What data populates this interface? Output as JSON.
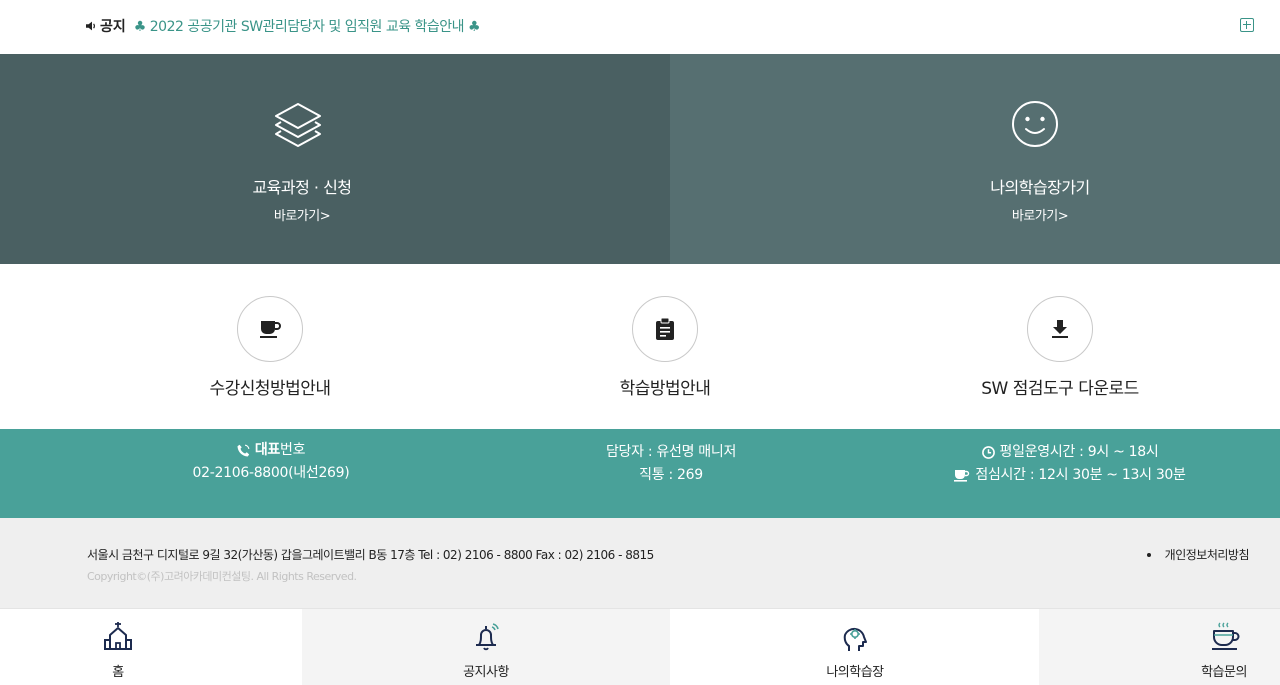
{
  "notice": {
    "label": "공지",
    "text": "♣ 2022 공공기관 SW관리담당자 및 임직원 교육 학습안내 ♣",
    "icons": {
      "speaker": "speaker-icon",
      "more": "plus-box-icon"
    }
  },
  "hero": {
    "left": {
      "title": "교육과정 · 신청",
      "link": "바로가기>",
      "icon": "layers-icon"
    },
    "right": {
      "title": "나의학습장가기",
      "link": "바로가기>",
      "icon": "smile-icon"
    }
  },
  "quick": [
    {
      "label": "수강신청방법안내",
      "icon": "coffee-cup-icon"
    },
    {
      "label": "학습방법안내",
      "icon": "clipboard-icon"
    },
    {
      "label": "SW 점검도구 다운로드",
      "icon": "download-icon"
    }
  ],
  "contact": {
    "phone_label_bold": "대표",
    "phone_label_rest": "번호",
    "phone_number": "02-2106-8800(내선269)",
    "manager": "담당자 : 유선명 매니저",
    "direct": "직통 : 269",
    "hours": "평일운영시간 : 9시 ~ 18시",
    "lunch": "점심시간 : 12시 30분 ~ 13시 30분"
  },
  "footer": {
    "address": "서울시 금천구 디지털로 9길 32(가산동) 갑을그레이트밸리 B동 17층 Tel : 02) 2106 - 8800 Fax : 02) 2106 - 8815",
    "copyright": "Copyright©(주)고려아카데미컨설팅. All Rights Reserved.",
    "policy": "개인정보처리방침"
  },
  "bottom_nav": [
    {
      "label": "홈",
      "icon": "home-icon"
    },
    {
      "label": "공지사항",
      "icon": "bell-icon"
    },
    {
      "label": "나의학습장",
      "icon": "head-icon"
    },
    {
      "label": "학습문의",
      "icon": "tea-cup-icon"
    }
  ],
  "colors": {
    "accent": "#49a199",
    "notice_text": "#3a9488",
    "hero_left": "#4a6062",
    "hero_right": "#566f71",
    "footer_bg": "#efefef"
  }
}
